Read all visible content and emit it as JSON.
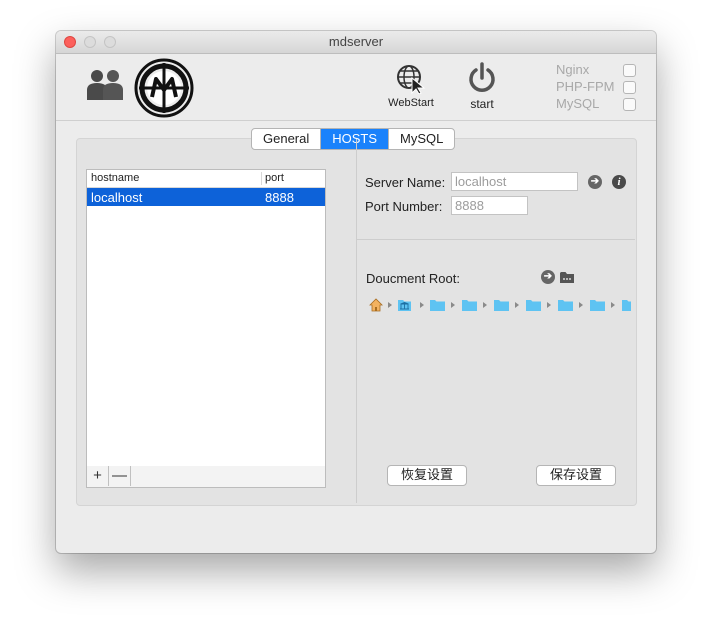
{
  "window": {
    "title": "mdserver"
  },
  "toolbar": {
    "webstart_label": "WebStart",
    "start_label": "start",
    "services": [
      {
        "label": "Nginx",
        "checked": false
      },
      {
        "label": "PHP-FPM",
        "checked": false
      },
      {
        "label": "MySQL",
        "checked": false
      }
    ]
  },
  "tabs": [
    {
      "label": "General",
      "active": false
    },
    {
      "label": "HOSTS",
      "active": true
    },
    {
      "label": "MySQL",
      "active": false
    }
  ],
  "hosts_table": {
    "columns": [
      "hostname",
      "port"
    ],
    "rows": [
      {
        "hostname": "localhost",
        "port": "8888",
        "selected": true
      }
    ],
    "add_label": "+",
    "remove_label": "—"
  },
  "form": {
    "server_name_label": "Server Name:",
    "server_name_placeholder": "localhost",
    "port_label": "Port Number:",
    "port_placeholder": "8888",
    "doc_root_label": "Doucment Root:"
  },
  "buttons": {
    "restore": "恢复设置",
    "save": "保存设置"
  },
  "colors": {
    "accent": "#1a82fb",
    "selection": "#0d62d9",
    "folder": "#5ec3f2",
    "close": "#fc605c"
  }
}
